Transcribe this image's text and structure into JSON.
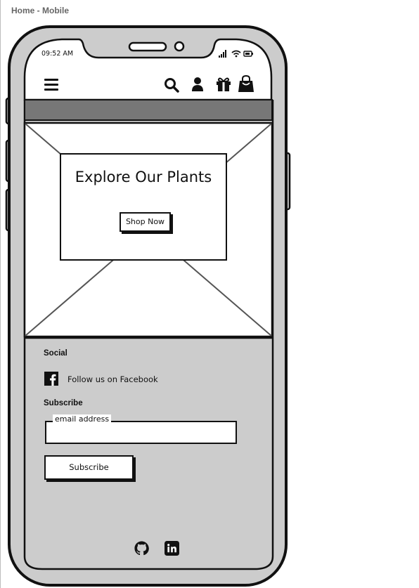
{
  "frame": {
    "title": "Home - Mobile"
  },
  "status_bar": {
    "time": "09:52 AM"
  },
  "nav": {
    "menu_icon": "hamburger-menu-icon",
    "search_icon": "search-icon",
    "account_icon": "user-icon",
    "gift_icon": "gift-icon",
    "bag_icon": "shopping-bag-icon"
  },
  "hero": {
    "title": "Explore Our Plants",
    "cta_label": "Shop Now"
  },
  "footer": {
    "social_heading": "Social",
    "facebook_label": "Follow us on Facebook",
    "subscribe_heading": "Subscribe",
    "email_legend": "email address",
    "email_value": "",
    "subscribe_button": "Subscribe",
    "icons": [
      "github-icon",
      "linkedin-icon"
    ]
  },
  "colors": {
    "outline": "#111111",
    "phone_gray": "#cccccc",
    "banner_bar": "#777777",
    "screen_white": "#ffffff"
  }
}
